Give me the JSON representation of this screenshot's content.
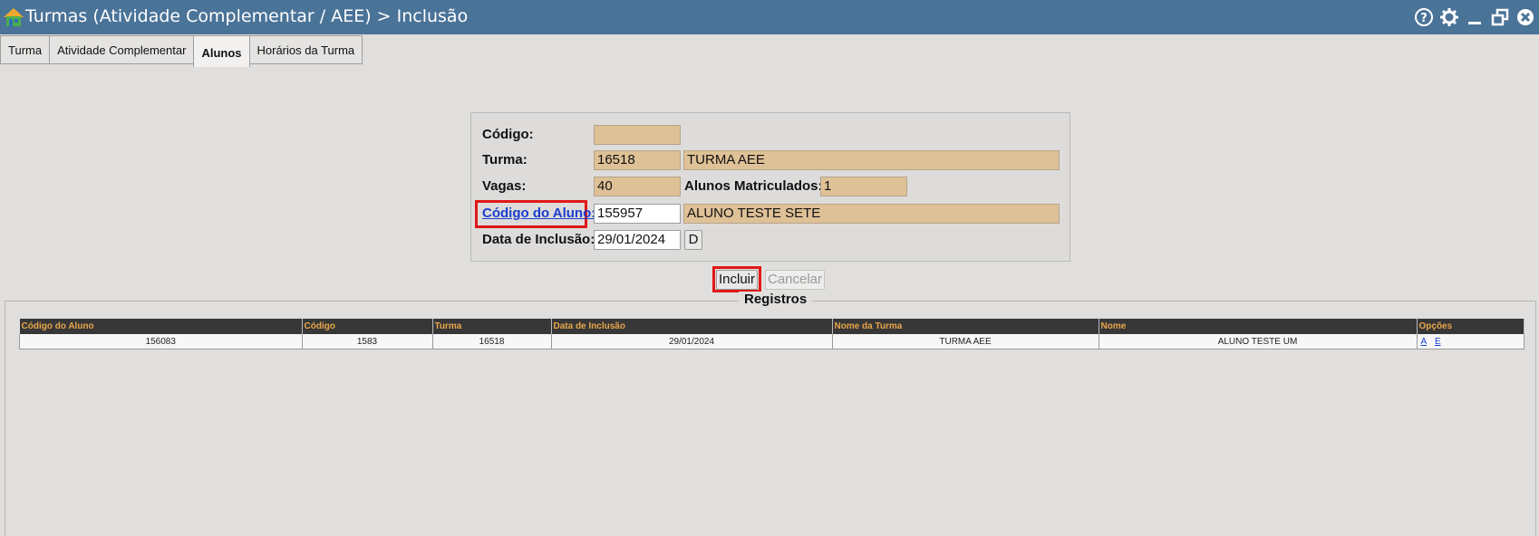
{
  "window": {
    "title": "Turmas (Atividade Complementar / AEE) > Inclusão"
  },
  "tabs": [
    {
      "label": "Turma",
      "active": false
    },
    {
      "label": "Atividade Complementar",
      "active": false
    },
    {
      "label": "Alunos",
      "active": true
    },
    {
      "label": "Horários da Turma",
      "active": false
    }
  ],
  "form": {
    "codigo_label": "Código:",
    "codigo_value": "",
    "turma_label": "Turma:",
    "turma_code": "16518",
    "turma_name": "TURMA AEE",
    "vagas_label": "Vagas:",
    "vagas_value": "40",
    "alunos_matriculados_label": "Alunos Matriculados:",
    "alunos_matriculados_value": "1",
    "codigo_aluno_label": "Código do Aluno:",
    "codigo_aluno_value": "155957",
    "aluno_name": "ALUNO TESTE SETE",
    "data_inclusao_label": "Data de Inclusão:",
    "data_inclusao_value": "29/01/2024",
    "date_button": "D"
  },
  "actions": {
    "incluir": "Incluir",
    "cancelar": "Cancelar"
  },
  "registros": {
    "legend": "Registros",
    "columns": [
      "Código do Aluno",
      "Código",
      "Turma",
      "Data de Inclusão",
      "Nome da Turma",
      "Nome",
      "Opções"
    ],
    "rows": [
      {
        "codigo_aluno": "156083",
        "codigo": "1583",
        "turma": "16518",
        "data_inclusao": "29/01/2024",
        "nome_turma": "TURMA AEE",
        "nome": "ALUNO TESTE UM",
        "opcao_a": "A",
        "opcao_e": "E"
      }
    ]
  },
  "colors": {
    "titlebar": "#4a7398",
    "readonly_field": "#dfc197",
    "header_bg": "#373737",
    "header_text": "#e9a64a",
    "highlight": "#e01818"
  }
}
